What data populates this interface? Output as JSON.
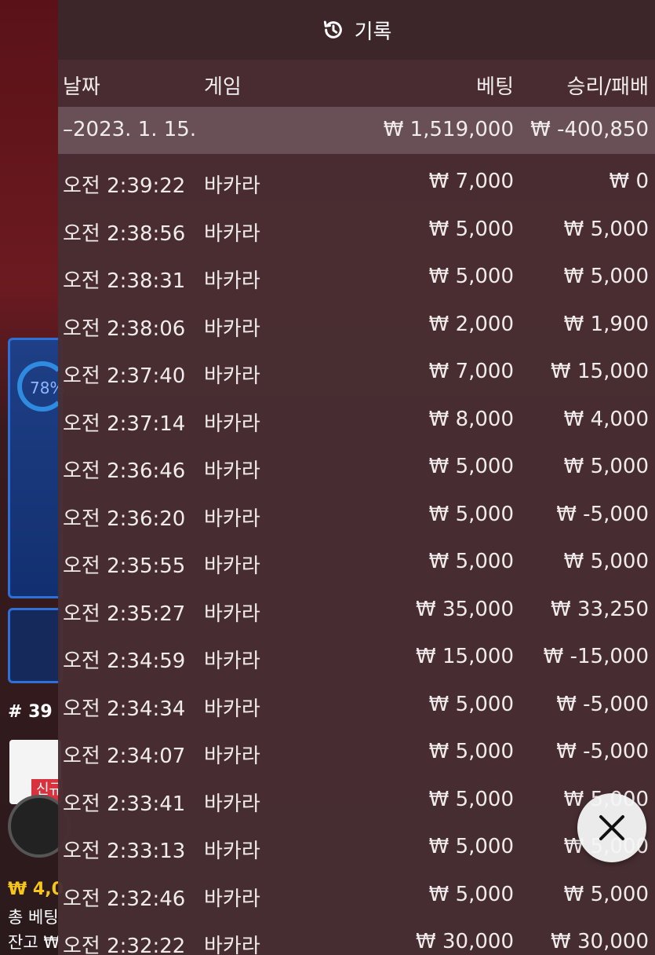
{
  "header": {
    "title": "기록"
  },
  "columns": {
    "date": "날짜",
    "game": "게임",
    "bet": "베팅",
    "win_loss": "승리/패배"
  },
  "summary": {
    "date": "–2023. 1. 15.",
    "bet": "₩ 1,519,000",
    "win_loss": "₩ -400,850"
  },
  "rows": [
    {
      "time": "오전 2:39:22",
      "game": "바카라",
      "bet": "₩ 7,000",
      "win_loss": "₩ 0"
    },
    {
      "time": "오전 2:38:56",
      "game": "바카라",
      "bet": "₩ 5,000",
      "win_loss": "₩ 5,000"
    },
    {
      "time": "오전 2:38:31",
      "game": "바카라",
      "bet": "₩ 5,000",
      "win_loss": "₩ 5,000"
    },
    {
      "time": "오전 2:38:06",
      "game": "바카라",
      "bet": "₩ 2,000",
      "win_loss": "₩ 1,900"
    },
    {
      "time": "오전 2:37:40",
      "game": "바카라",
      "bet": "₩ 7,000",
      "win_loss": "₩ 15,000"
    },
    {
      "time": "오전 2:37:14",
      "game": "바카라",
      "bet": "₩ 8,000",
      "win_loss": "₩ 4,000"
    },
    {
      "time": "오전 2:36:46",
      "game": "바카라",
      "bet": "₩ 5,000",
      "win_loss": "₩ 5,000"
    },
    {
      "time": "오전 2:36:20",
      "game": "바카라",
      "bet": "₩ 5,000",
      "win_loss": "₩ -5,000"
    },
    {
      "time": "오전 2:35:55",
      "game": "바카라",
      "bet": "₩ 5,000",
      "win_loss": "₩ 5,000"
    },
    {
      "time": "오전 2:35:27",
      "game": "바카라",
      "bet": "₩ 35,000",
      "win_loss": "₩ 33,250"
    },
    {
      "time": "오전 2:34:59",
      "game": "바카라",
      "bet": "₩ 15,000",
      "win_loss": "₩ -15,000"
    },
    {
      "time": "오전 2:34:34",
      "game": "바카라",
      "bet": "₩ 5,000",
      "win_loss": "₩ -5,000"
    },
    {
      "time": "오전 2:34:07",
      "game": "바카라",
      "bet": "₩ 5,000",
      "win_loss": "₩ -5,000"
    },
    {
      "time": "오전 2:33:41",
      "game": "바카라",
      "bet": "₩ 5,000",
      "win_loss": "₩ 5,000"
    },
    {
      "time": "오전 2:33:13",
      "game": "바카라",
      "bet": "₩ 5,000",
      "win_loss": "₩ 5,000"
    },
    {
      "time": "오전 2:32:46",
      "game": "바카라",
      "bet": "₩ 5,000",
      "win_loss": "₩ 5,000"
    },
    {
      "time": "오전 2:32:22",
      "game": "바카라",
      "bet": "₩ 30,000",
      "win_loss": "₩ 30,000"
    }
  ],
  "background": {
    "progress_label": "78%",
    "round": "# 39",
    "new_badge": "신규",
    "bet_amount": "₩ 4,0",
    "total_bet": "총 베팅",
    "balance": "잔고 ₩"
  },
  "icons": {
    "history": "history-icon",
    "close": "close-icon"
  }
}
